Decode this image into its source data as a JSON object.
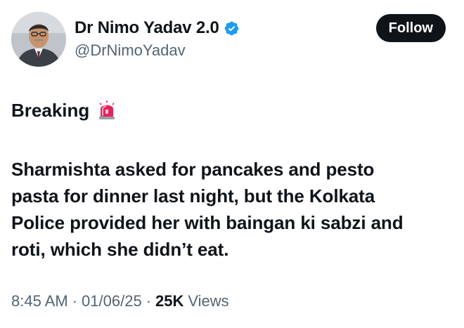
{
  "author": {
    "display_name": "Dr Nimo Yadav 2.0",
    "handle": "@DrNimoYadav",
    "verified": true,
    "verified_color": "#1d9bf0",
    "avatar_icon": "avatar-photo-man-in-suit"
  },
  "follow_button": {
    "label": "Follow",
    "background": "#0f1419"
  },
  "tweet": {
    "headline": "Breaking",
    "headline_icon": "siren-icon",
    "text_lines": [
      "Sharmishta asked for pancakes and pesto",
      "pasta for dinner last night, but the Kolkata",
      "Police provided her with baingan ki sabzi and",
      "roti, which she didn’t eat."
    ]
  },
  "meta": {
    "time": "8:45 AM",
    "separator": "·",
    "date": "01/06/25",
    "views_count": "25K",
    "views_label": "Views"
  }
}
